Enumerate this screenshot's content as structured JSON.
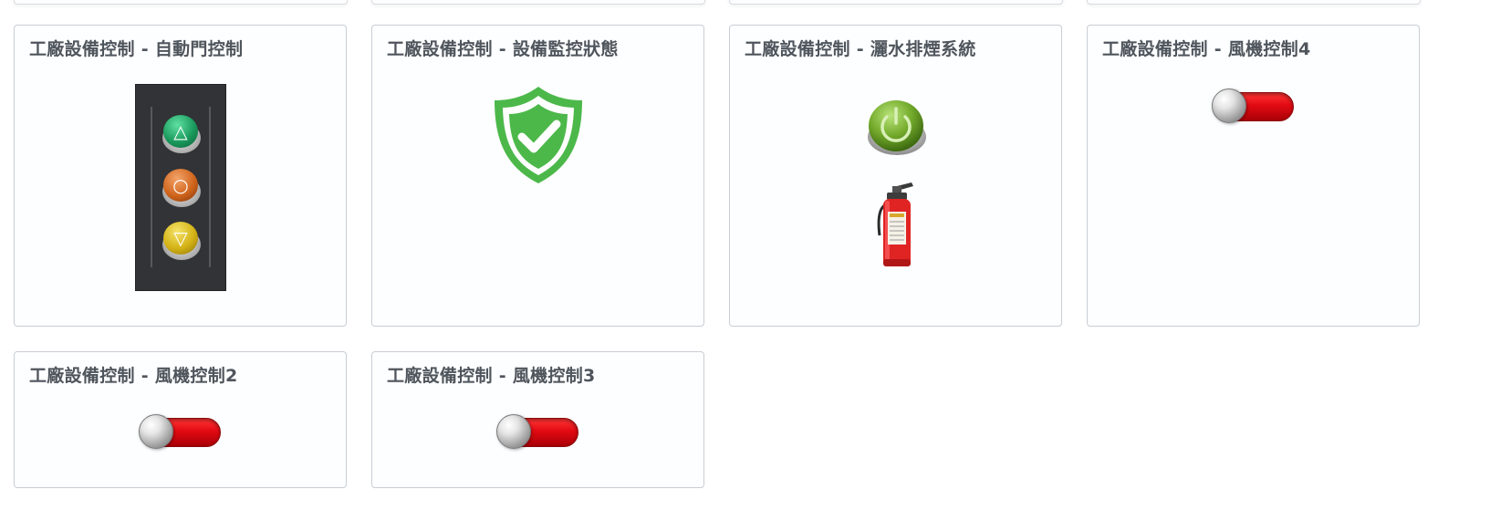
{
  "cards": [
    {
      "title": "工廠設備控制 - 自動門控制"
    },
    {
      "title": "工廠設備控制 - 設備監控狀態"
    },
    {
      "title": "工廠設備控制 - 灑水排煙系統"
    },
    {
      "title": "工廠設備控制 - 風機控制4"
    },
    {
      "title": "工廠設備控制 - 風機控制2"
    },
    {
      "title": "工廠設備控制 - 風機控制3"
    }
  ],
  "door_controls": {
    "up_glyph": "△",
    "stop_glyph": "○",
    "down_glyph": "▽",
    "colors": {
      "up": "#1a9a5c",
      "stop": "#d0651c",
      "down": "#d3b215"
    }
  },
  "status": {
    "state": "ok",
    "color": "#4cb84a"
  },
  "fan_switches": {
    "fan4": {
      "state": "off"
    },
    "fan2": {
      "state": "off"
    },
    "fan3": {
      "state": "off"
    }
  },
  "colors": {
    "switch_track": "#e20a12",
    "power_button": "#74ab2c",
    "extinguisher": "#e02323"
  }
}
